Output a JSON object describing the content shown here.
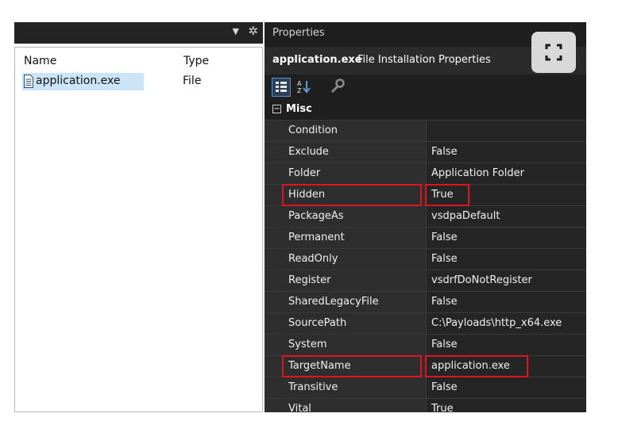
{
  "file_list": {
    "columns": {
      "name": "Name",
      "type": "Type"
    },
    "items": [
      {
        "name": "application.exe",
        "type": "File"
      }
    ]
  },
  "left_toolbar": {
    "dropdown_icon": "dropdown-arrow-icon",
    "settings_icon": "gear-icon"
  },
  "properties": {
    "title": "Properties",
    "object_name": "application.exe",
    "object_description": "File Installation Properties",
    "toolbar": [
      "categorized-icon",
      "alphabetical-icon",
      "property-pages-icon"
    ],
    "category": "Misc",
    "rows": [
      {
        "name": "Condition",
        "value": ""
      },
      {
        "name": "Exclude",
        "value": "False"
      },
      {
        "name": "Folder",
        "value": "Application Folder"
      },
      {
        "name": "Hidden",
        "value": "True"
      },
      {
        "name": "PackageAs",
        "value": "vsdpaDefault"
      },
      {
        "name": "Permanent",
        "value": "False"
      },
      {
        "name": "ReadOnly",
        "value": "False"
      },
      {
        "name": "Register",
        "value": "vsdrfDoNotRegister"
      },
      {
        "name": "SharedLegacyFile",
        "value": "False"
      },
      {
        "name": "SourcePath",
        "value": "C:\\Payloads\\http_x64.exe"
      },
      {
        "name": "System",
        "value": "False"
      },
      {
        "name": "TargetName",
        "value": "application.exe"
      },
      {
        "name": "Transitive",
        "value": "False"
      },
      {
        "name": "Vital",
        "value": "True"
      }
    ]
  },
  "colors": {
    "highlight_box": "#e0141e",
    "selection": "#cce4f7",
    "panel_bg": "#1f1f1f"
  }
}
